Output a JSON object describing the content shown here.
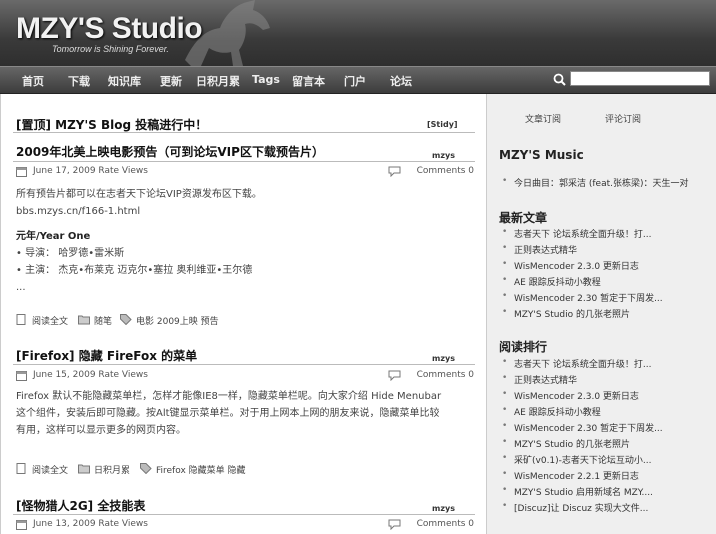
{
  "header": {
    "logo": "MZY'S Studio",
    "tagline": "Tomorrow is Shining Forever."
  },
  "nav": {
    "items": [
      "首页",
      "下载",
      "知识库",
      "更新",
      "日积月累",
      "Tags",
      "留言本",
      "门户",
      "论坛"
    ],
    "search_value": ""
  },
  "sticky": {
    "title": "[置顶] MZY'S Blog 投稿进行中！",
    "label": "[Stidy]"
  },
  "posts": [
    {
      "title": "2009年北美上映电影预告（可到论坛VIP区下载预告片）",
      "author": "mzys",
      "date": "June 17, 2009 Rate  Views",
      "comments": "Comments 0",
      "lines": [
        "所有预告片都可以在志者天下论坛VIP资源发布区下载。",
        "bbs.mzys.cn/f166-1.html",
        "",
        "元年/Year One",
        "• 导演： 哈罗德•雷米斯",
        "• 主演： 杰克•布莱克 迈克尔•塞拉 奥利维亚•王尔德",
        "..."
      ],
      "read_more": "阅读全文",
      "category": "随笔",
      "tags": "电影  2009上映  预告"
    },
    {
      "title": "[Firefox] 隐藏 FireFox 的菜单",
      "author": "mzys",
      "date": "June 15, 2009 Rate  Views",
      "comments": "Comments 0",
      "lines": [
        "Firefox 默认不能隐藏菜单栏，怎样才能像IE8一样，隐藏菜单栏呢。向大家介绍 Hide Menubar",
        "这个组件，安装后即可隐藏。按Alt键显示菜单栏。对于用上网本上网的朋友来说，隐藏菜单比较",
        "有用，这样可以显示更多的网页内容。"
      ],
      "read_more": "阅读全文",
      "category": "日积月累",
      "tags": "Firefox  隐藏菜单  隐藏"
    },
    {
      "title": "[怪物猎人2G] 全技能表",
      "author": "mzys",
      "date": "June 13, 2009 Rate  Views",
      "comments": "Comments 0"
    }
  ],
  "sidebar": {
    "tabs": [
      "文章订阅",
      "评论订阅"
    ],
    "music_title": "MZY'S Music",
    "music_items": [
      "今日曲目：郭采洁 (feat.张栋梁)：天生一对"
    ],
    "latest_title": "最新文章",
    "latest_items": [
      "志者天下 论坛系统全面升级！打...",
      "正则表达式精华",
      "WisMencoder 2.3.0 更新日志",
      "AE 跟踪反抖动小教程",
      "WisMencoder 2.30 暂定于下周发...",
      "MZY'S Studio 的几张老照片"
    ],
    "popular_title": "阅读排行",
    "popular_items": [
      "志者天下 论坛系统全面升级！打...",
      "正则表达式精华",
      "WisMencoder 2.3.0 更新日志",
      "AE 跟踪反抖动小教程",
      "WisMencoder 2.30 暂定于下周发...",
      "MZY'S Studio 的几张老照片",
      "采矿(v0.1)-志者天下论坛互动小...",
      "WisMencoder 2.2.1 更新日志",
      "MZY'S Studio 启用新域名 MZY....",
      "[Discuz]让 Discuz 实现大文件..."
    ]
  }
}
